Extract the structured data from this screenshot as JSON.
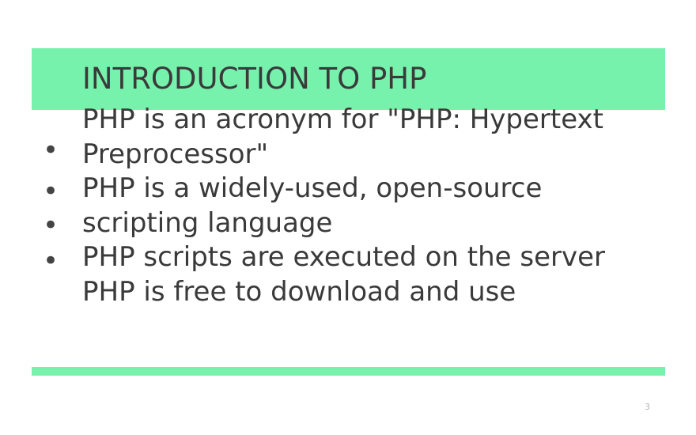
{
  "slide": {
    "title": "INTRODUCTION TO PHP",
    "bullet_glyph": "•",
    "lines": [
      "PHP is an acronym for \"PHP: Hypertext",
      "Preprocessor\"",
      "PHP is a widely-used, open-source",
      "scripting language",
      "PHP scripts are executed on the server",
      "PHP is free to download and use"
    ],
    "page_number": "3"
  },
  "colors": {
    "accent": "#77f2ad",
    "text": "#3a3a3a",
    "page_number": "#b3b3b3"
  }
}
